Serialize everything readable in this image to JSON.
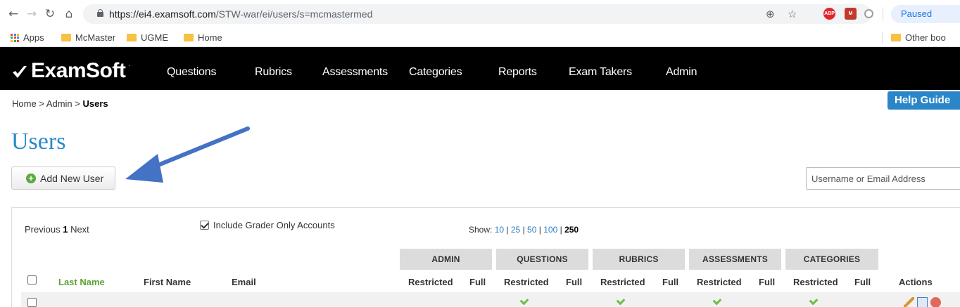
{
  "browser": {
    "url_host": "https://ei4.examsoft.com",
    "url_path": "/STW-war/ei/users/s=mcmastermed",
    "paused_label": "Paused",
    "bookmarks": [
      "Apps",
      "McMaster",
      "UGME",
      "Home"
    ],
    "other_bookmarks": "Other boo"
  },
  "nav": {
    "logo": "ExamSoft",
    "items": [
      "Questions",
      "Rubrics",
      "Assessments",
      "Categories",
      "Reports",
      "Exam Takers",
      "Admin"
    ]
  },
  "breadcrumb": {
    "home": "Home",
    "sep": ">",
    "admin": "Admin",
    "current": "Users"
  },
  "help_guide": "Help Guide",
  "page_title": "Users",
  "add_user_label": "Add New User",
  "search": {
    "placeholder": "Username or Email Address"
  },
  "pager": {
    "prev": "Previous",
    "page": "1",
    "next": "Next"
  },
  "grader_label": "Include Grader Only Accounts",
  "show": {
    "label": "Show:",
    "options": [
      "10",
      "25",
      "50",
      "100"
    ],
    "current": "250",
    "sep": "|"
  },
  "group_headers": [
    "ADMIN",
    "QUESTIONS",
    "RUBRICS",
    "ASSESSMENTS",
    "CATEGORIES"
  ],
  "columns": {
    "last_name": "Last Name",
    "first_name": "First Name",
    "email": "Email",
    "restricted": "Restricted",
    "full": "Full",
    "actions": "Actions"
  },
  "colors": {
    "accent": "#2a8ac9",
    "nav_bg": "#000000",
    "green": "#5aa336"
  }
}
